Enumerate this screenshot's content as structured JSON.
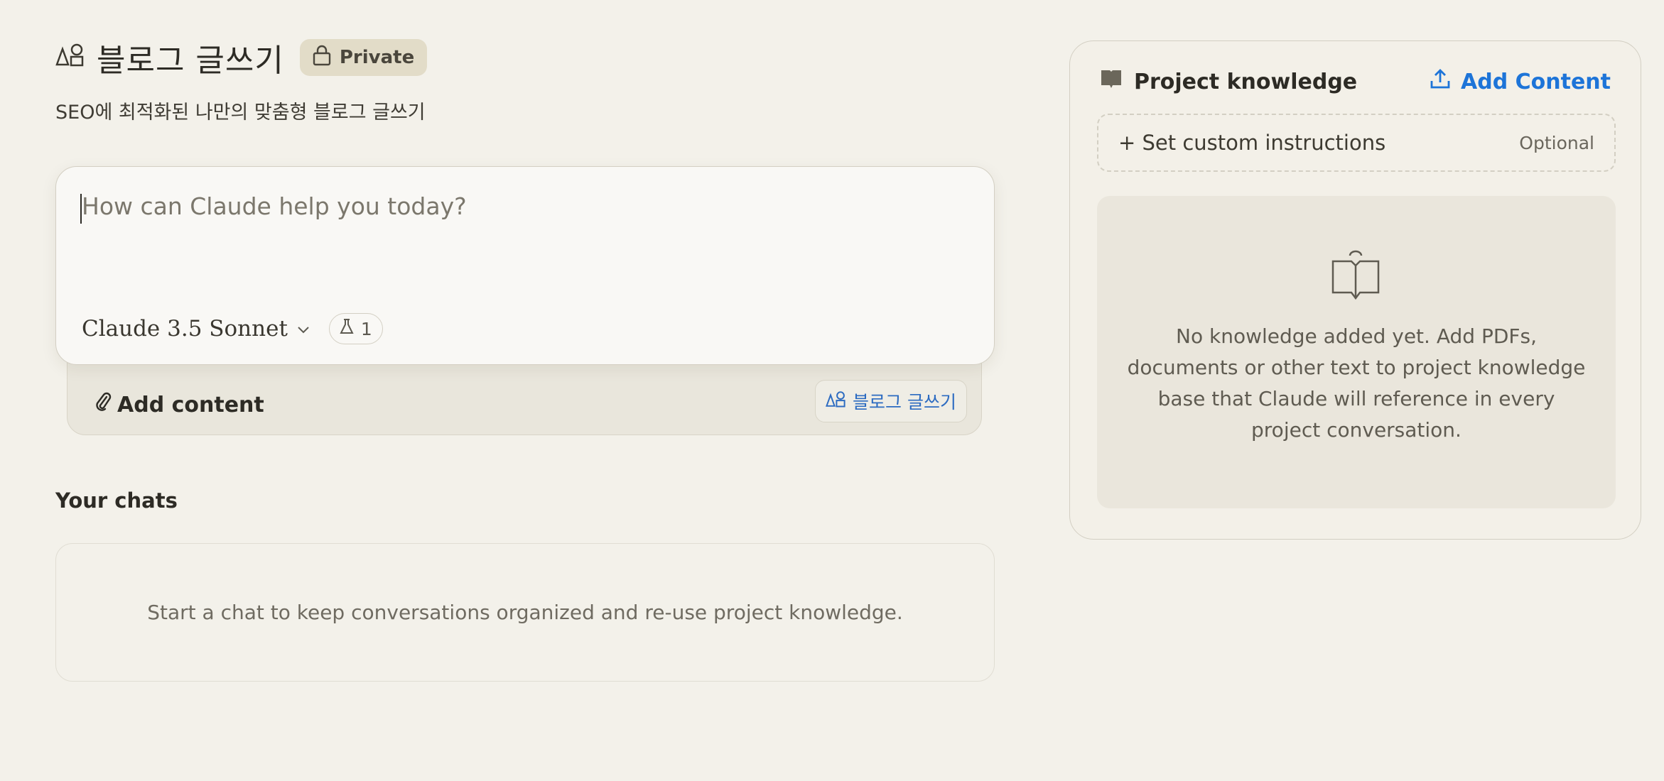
{
  "project": {
    "title_icon": "project-shapes-icon",
    "title": "블로그 글쓰기",
    "visibility_label": "Private",
    "description": "SEO에 최적화된 나만의 맞춤형 블로그 글쓰기"
  },
  "composer": {
    "placeholder": "How can Claude help you today?",
    "model_name": "Claude 3.5 Sonnet",
    "feature_count": "1",
    "add_content_label": "Add content",
    "project_chip_label": "블로그 글쓰기"
  },
  "chats": {
    "heading": "Your chats",
    "empty_message": "Start a chat to keep conversations organized and re-use project knowledge."
  },
  "knowledge_panel": {
    "title": "Project knowledge",
    "add_content_label": "Add Content",
    "custom_instructions_label": "+ Set custom instructions",
    "custom_instructions_hint": "Optional",
    "empty_message": "No knowledge added yet. Add PDFs, documents or other text to project knowledge base that Claude will reference in every project conversation."
  },
  "colors": {
    "background": "#f3f1ea",
    "accent_link": "#1d74d8",
    "private_badge": "#e2dcc8"
  }
}
